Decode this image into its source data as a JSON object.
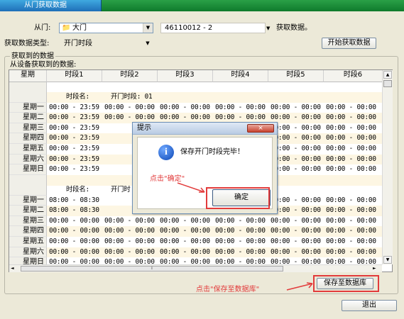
{
  "title": {
    "tab": "从门获取数据"
  },
  "form": {
    "door_label": "从门:",
    "door_value": "大门",
    "device_value": "46110012 - 2",
    "fetch_label": "获取数据。",
    "type_label": "获取数据类型:",
    "type_value": "开门时段",
    "start_button": "开始获取数据"
  },
  "group": {
    "title": "获取到的数据",
    "subtitle": "从设备获取到的数据:"
  },
  "grid": {
    "headers": [
      "星期",
      "时段1",
      "时段2",
      "时段3",
      "时段4",
      "时段5",
      "时段6"
    ],
    "section1": {
      "name_label": "时段名:",
      "name_value": "开门时段: 01"
    },
    "section2": {
      "name_label": "时段名:",
      "name_value": "开门时"
    },
    "days": [
      "星期一",
      "星期二",
      "星期三",
      "星期四",
      "星期五",
      "星期六",
      "星期日"
    ],
    "rows_block1": [
      [
        "00:00 - 23:59",
        "00:00 - 00:00",
        "00:00 - 00:00",
        "00:00 - 00:00",
        "00:00 - 00:00",
        "00:00 - 00:00"
      ],
      [
        "00:00 - 23:59",
        "00:00 - 00:00",
        "00:00 - 00:00",
        "00:00 - 00:00",
        "00:00 - 00:00",
        "00:00 - 00:00"
      ],
      [
        "00:00 - 23:59",
        "",
        "",
        "",
        "00:00 - 00:00",
        "00:00 - 00:00"
      ],
      [
        "00:00 - 23:59",
        "",
        "",
        "",
        "00:00 - 00:00",
        "00:00 - 00:00"
      ],
      [
        "00:00 - 23:59",
        "",
        "",
        "",
        "00:00 - 00:00",
        "00:00 - 00:00"
      ],
      [
        "00:00 - 23:59",
        "",
        "",
        "",
        "00:00 - 00:00",
        "00:00 - 00:00"
      ],
      [
        "00:00 - 23:59",
        "",
        "",
        "",
        "00:00 - 00:00",
        "00:00 - 00:00"
      ]
    ],
    "rows_block2": [
      [
        "08:00 - 08:30",
        "",
        "",
        "",
        "00:00 - 00:00",
        "00:00 - 00:00"
      ],
      [
        "08:00 - 08:30",
        "",
        "",
        "",
        "00:00 - 00:00",
        "00:00 - 00:00"
      ],
      [
        "00:00 - 00:00",
        "00:00 - 00:00",
        "00:00 - 00:00",
        "00:00 - 00:00",
        "00:00 - 00:00",
        "00:00 - 00:00"
      ],
      [
        "00:00 - 00:00",
        "00:00 - 00:00",
        "00:00 - 00:00",
        "00:00 - 00:00",
        "00:00 - 00:00",
        "00:00 - 00:00"
      ],
      [
        "00:00 - 00:00",
        "00:00 - 00:00",
        "00:00 - 00:00",
        "00:00 - 00:00",
        "00:00 - 00:00",
        "00:00 - 00:00"
      ],
      [
        "00:00 - 00:00",
        "00:00 - 00:00",
        "00:00 - 00:00",
        "00:00 - 00:00",
        "00:00 - 00:00",
        "00:00 - 00:00"
      ],
      [
        "00:00 - 00:00",
        "00:00 - 00:00",
        "00:00 - 00:00",
        "00:00 - 00:00",
        "00:00 - 00:00",
        "00:00 - 00:00"
      ]
    ]
  },
  "dialog": {
    "title": "提示",
    "message": "保存开门时段完毕！",
    "ok_button": "确定",
    "close_glyph": "×",
    "info_glyph": "i"
  },
  "annotations": {
    "click_ok": "点击\"确定\"",
    "click_save": "点击\"保存至数据库\""
  },
  "buttons": {
    "save": "保存至数据库",
    "exit": "退出"
  },
  "colors": {
    "annotation": "#e23b3b",
    "titlebar": "#1f8a3b",
    "row_alt": "#fdf6e3"
  }
}
